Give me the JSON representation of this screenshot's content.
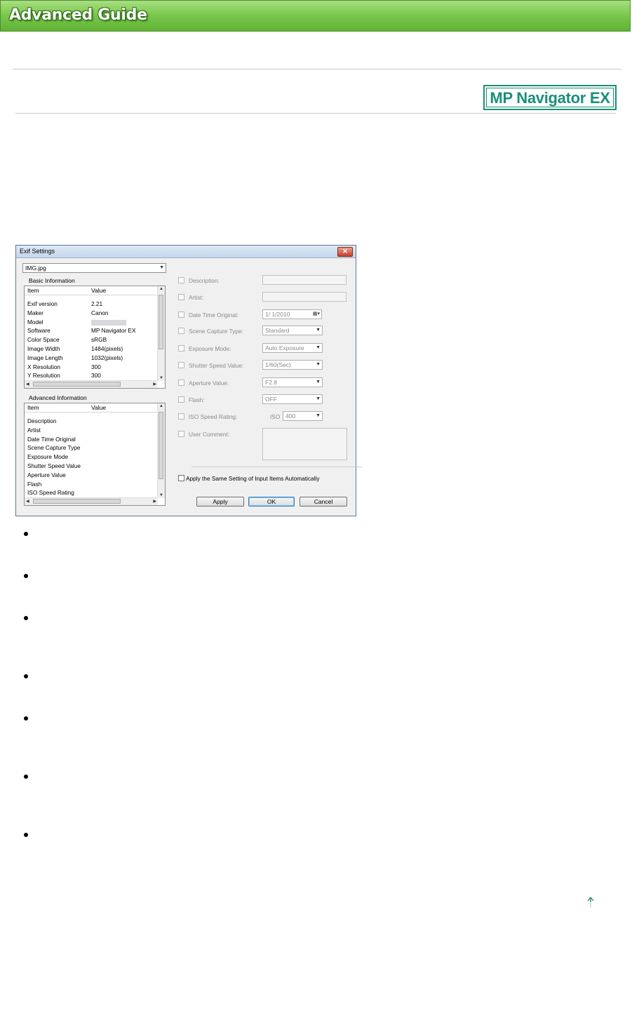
{
  "header": {
    "title": "Advanced Guide"
  },
  "badge": {
    "text": "MP Navigator EX"
  },
  "dialog": {
    "title": "Exif Settings",
    "file_select": "IMG.jpg",
    "basic": {
      "label": "Basic Information",
      "col_item": "Item",
      "col_value": "Value",
      "rows": [
        {
          "item": "Exif version",
          "value": "2.21"
        },
        {
          "item": "Maker",
          "value": "Canon"
        },
        {
          "item": "Model",
          "value": ""
        },
        {
          "item": "Software",
          "value": "MP Navigator EX"
        },
        {
          "item": "Color Space",
          "value": "sRGB"
        },
        {
          "item": "Image Width",
          "value": "1484(pixels)"
        },
        {
          "item": "Image Length",
          "value": "1032(pixels)"
        },
        {
          "item": "X Resolution",
          "value": "300"
        },
        {
          "item": "Y Resolution",
          "value": "300"
        }
      ]
    },
    "advanced": {
      "label": "Advanced Information",
      "col_item": "Item",
      "col_value": "Value",
      "rows": [
        {
          "item": "Description"
        },
        {
          "item": "Artist"
        },
        {
          "item": "Date Time Original"
        },
        {
          "item": "Scene Capture Type"
        },
        {
          "item": "Exposure Mode"
        },
        {
          "item": "Shutter Speed Value"
        },
        {
          "item": "Aperture Value"
        },
        {
          "item": "Flash"
        },
        {
          "item": "ISO Speed Rating"
        }
      ]
    },
    "fields": {
      "description": "Description:",
      "artist": "Artist:",
      "date_time": "Date Time Original:",
      "date_value": "1/  1/2010",
      "scene": "Scene Capture Type:",
      "scene_value": "Standard",
      "exposure": "Exposure Mode:",
      "exposure_value": "Auto Exposure",
      "shutter": "Shutter Speed Value:",
      "shutter_value": "1/60(Sec)",
      "aperture": "Aperture Value:",
      "aperture_value": "F2.8",
      "flash": "Flash:",
      "flash_value": "OFF",
      "iso": "ISO Speed Rating:",
      "iso_prefix": "ISO",
      "iso_value": "400",
      "user_comment": "User Comment:"
    },
    "apply_same": "Apply the Same Setting of Input Items Automatically",
    "buttons": {
      "apply": "Apply",
      "ok": "OK",
      "cancel": "Cancel"
    }
  }
}
